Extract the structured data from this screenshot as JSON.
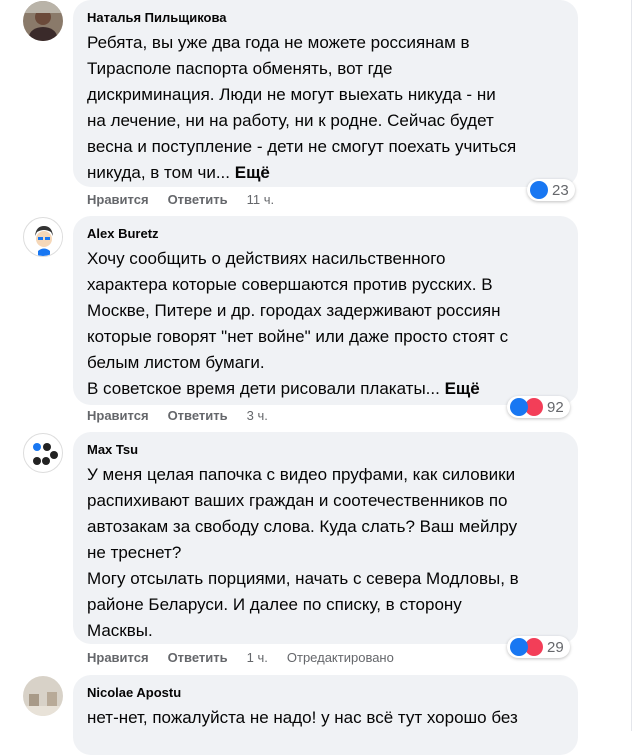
{
  "comments": [
    {
      "author": "Наталья Пильщикова",
      "lines": [
        "Ребята, вы уже два года не можете россиянам в",
        "Тирасполе паспорта обменять, вот где",
        "дискриминация. Люди не могут выехать никуда - ни",
        "на лечение, ни на работу, ни к родне. Сейчас будет",
        "весна и поступление - дети не смогут поехать учиться",
        "никуда, в том чи..."
      ],
      "more": "Ещё",
      "like": "Нравится",
      "reply": "Ответить",
      "time": "11 ч.",
      "reactions": [
        "like"
      ],
      "count": "23"
    },
    {
      "author": "Alex Buretz",
      "lines": [
        "Хочу сообщить о действиях насильственного",
        "характера которые совершаются против русских. В",
        "Москве, Питере и др. городах задерживают россиян",
        "которые говорят \"нет войне\" или даже просто стоят с",
        "белым листом бумаги.",
        "В советское время дети рисовали плакаты..."
      ],
      "more": "Ещё",
      "like": "Нравится",
      "reply": "Ответить",
      "time": "3 ч.",
      "reactions": [
        "like",
        "love"
      ],
      "count": "92"
    },
    {
      "author": "Max Tsu",
      "lines": [
        "У меня целая папочка с видео пруфами, как силовики",
        "распихивают ваших граждан и соотечественников по",
        "автозакам за свободу слова. Куда слать? Ваш мейлру",
        "не треснет?",
        "Могу отсылать порциями, начать с севера Модловы, в",
        "районе Беларуси. И далее по списку, в сторону",
        "Масквы."
      ],
      "like": "Нравится",
      "reply": "Ответить",
      "time": "1 ч.",
      "edited": "Отредактировано",
      "reactions": [
        "like",
        "love"
      ],
      "count": "29"
    },
    {
      "author": "Nicolae Apostu",
      "lines": [
        "нет-нет, пожалуйста не надо! у нас всё тут хорошо без"
      ]
    }
  ],
  "colors": {
    "bubble": "#f0f2f5",
    "like": "#1877f2",
    "love": "#f33e58",
    "meta": "#65676b"
  }
}
